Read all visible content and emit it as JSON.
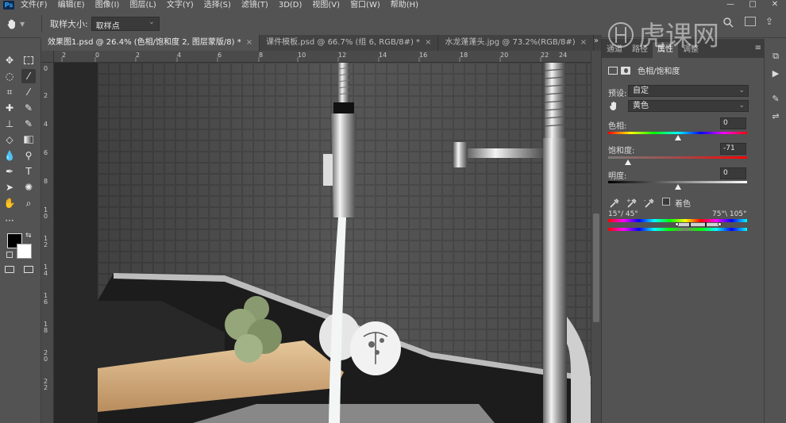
{
  "app": {
    "logo_text": "Ps",
    "menu": [
      "文件(F)",
      "编辑(E)",
      "图像(I)",
      "图层(L)",
      "文字(Y)",
      "选择(S)",
      "滤镜(T)",
      "3D(D)",
      "视图(V)",
      "窗口(W)",
      "帮助(H)"
    ],
    "window_controls": {
      "minimize": "—",
      "maximize": "□",
      "close": "✕"
    }
  },
  "options": {
    "tool_icon": "hand-icon",
    "sample_size_label": "取样大小:",
    "sample_size_value": "取样点"
  },
  "tabs": [
    {
      "label": "效果图1.psd @ 26.4% (色相/饱和度 2, 图层蒙版/8) *",
      "close": "×",
      "active": true
    },
    {
      "label": "课件模板.psd @ 66.7% (组 6, RGB/8#) *",
      "close": "×",
      "active": false
    },
    {
      "label": "水龙蓬蓬头.jpg @ 73.2%(RGB/8#)",
      "close": "×",
      "active": false
    }
  ],
  "tabs_more": "»",
  "rulers": {
    "top_ticks": [
      "2",
      "0",
      "2",
      "4",
      "6",
      "8",
      "10",
      "12",
      "14",
      "16",
      "18",
      "20",
      "22",
      "24"
    ],
    "left_ticks": [
      "0",
      "2",
      "4",
      "6",
      "8",
      "1 0",
      "1 2",
      "1 4",
      "1 6",
      "1 8",
      "2 0",
      "2 2"
    ]
  },
  "panel": {
    "tabs": [
      "通道",
      "路径",
      "属性",
      "调整"
    ],
    "active_tab": "属性",
    "menu": "≡",
    "adjustment_title": "色相/饱和度",
    "preset_label": "预设:",
    "preset_value": "自定",
    "channel_value": "黄色",
    "hue": {
      "label": "色相:",
      "value": "0",
      "fraction": 0.5
    },
    "saturation": {
      "label": "饱和度:",
      "value": "-71",
      "fraction": 0.145
    },
    "lightness": {
      "label": "明度:",
      "value": "0",
      "fraction": 0.5
    },
    "colorize_label": "着色",
    "range_left": "15°/ 45°",
    "range_right": "75°\\ 105°"
  },
  "watermark_text": "虎课网",
  "colors": {
    "ui_bg": "#535353",
    "dark": "#3a3a3a",
    "accent": "#31a8ff"
  }
}
